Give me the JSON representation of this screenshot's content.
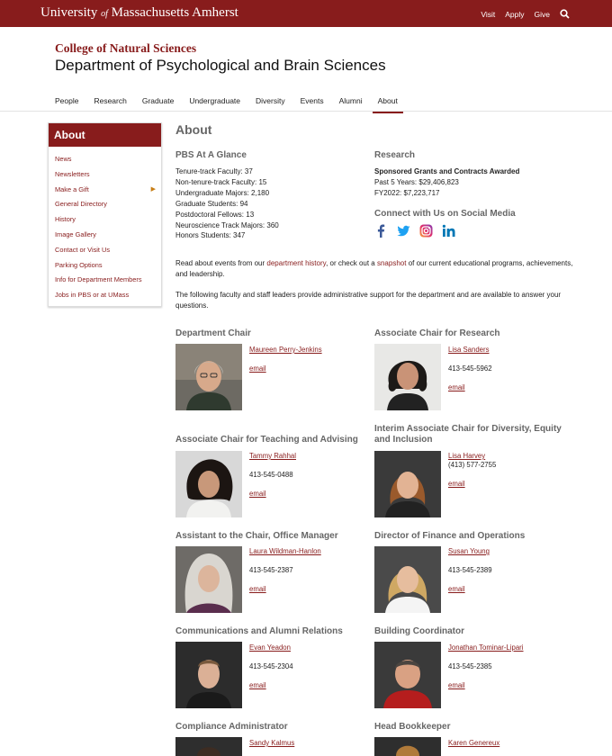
{
  "header": {
    "brand_main": "University",
    "brand_of": "of",
    "brand_rest": "Massachusetts Amherst",
    "links": [
      "Visit",
      "Apply",
      "Give"
    ]
  },
  "college": "College of Natural Sciences",
  "department": "Department of Psychological and Brain Sciences",
  "nav": [
    "People",
    "Research",
    "Graduate",
    "Undergraduate",
    "Diversity",
    "Events",
    "Alumni",
    "About"
  ],
  "sidebar": {
    "title": "About",
    "items": [
      "News",
      "Newsletters",
      "Make a Gift",
      "General Directory",
      "History",
      "Image Gallery",
      "Contact or Visit Us",
      "Parking Options",
      "Info for Department Members",
      "Jobs in PBS or at UMass"
    ]
  },
  "page_title": "About",
  "glance": {
    "heading": "PBS At A Glance",
    "lines": [
      "Tenure-track Faculty: 37",
      "Non-tenure-track Faculty: 15",
      "Undergraduate Majors: 2,180",
      "Graduate Students: 94",
      "Postdoctoral Fellows: 13",
      "Neuroscience Track Majors: 360",
      "Honors Students: 347"
    ]
  },
  "research": {
    "heading": "Research",
    "subheading": "Sponsored Grants and Contracts Awarded",
    "lines": [
      "Past 5 Years: $29,406,823",
      "FY2022: $7,223,717"
    ]
  },
  "social": {
    "heading": "Connect with Us on Social Media",
    "icons": [
      "facebook-icon",
      "twitter-icon",
      "instagram-icon",
      "linkedin-icon"
    ],
    "colors": {
      "facebook": "#3b5998",
      "twitter": "#1da1f2",
      "linkedin": "#0077b5"
    }
  },
  "intro": {
    "p1_before": "Read about events from our ",
    "p1_link1": "department history",
    "p1_mid": ", or check out a ",
    "p1_link2": "snapshot ",
    "p1_after": "of our current educational programs, achievements, and leadership.",
    "p2": "The following faculty and staff leaders provide administrative support for the department and are available to answer your questions."
  },
  "people": [
    {
      "role": "Department Chair",
      "name": "Maureen Perry-Jenkins",
      "phone": "",
      "email": "email"
    },
    {
      "role": "Associate Chair for Research",
      "name": "Lisa Sanders",
      "phone": "413-545-5962",
      "email": "email"
    },
    {
      "role": "Associate Chair for Teaching and Advising",
      "name": "Tammy Rahhal",
      "phone": "413-545-0488",
      "email": "email"
    },
    {
      "role": "Interim Associate Chair for Diversity, Equity and Inclusion",
      "name": "Lisa Harvey",
      "phone": "(413) 577-2755",
      "email": "email"
    },
    {
      "role": "Assistant to the Chair, Office Manager",
      "name": "Laura Wildman-Hanlon",
      "phone": "413-545-2387",
      "email": "email"
    },
    {
      "role": "Director of Finance and Operations",
      "name": "Susan Young",
      "phone": "413-545-2389",
      "email": "email"
    },
    {
      "role": "Communications and Alumni Relations",
      "name": "Evan Yeadon",
      "phone": "413-545-2304",
      "email": "email"
    },
    {
      "role": "Building Coordinator",
      "name": "Jonathan Tominar-Lipari",
      "phone": "413-545-2385",
      "email": "email"
    },
    {
      "role": "Compliance Administrator",
      "name": "Sandy Kalmus",
      "phone": "",
      "email": ""
    },
    {
      "role": "Head Bookkeeper",
      "name": "Karen Genereux",
      "phone": "",
      "email": ""
    }
  ],
  "theme": {
    "brand": "#881c1c",
    "accent": "#c77d14"
  }
}
